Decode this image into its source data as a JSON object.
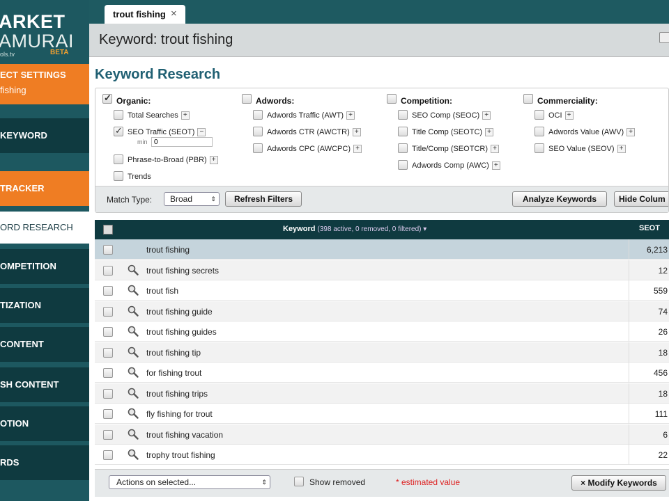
{
  "logo": {
    "line1": "ARKET",
    "line2": "AMURAI",
    "line3": "ols.tv",
    "beta": "BETA"
  },
  "sidebar": {
    "items": [
      {
        "label": "ECT SETTINGS",
        "sub": "fishing"
      },
      {
        "label": "KEYWORD"
      },
      {
        "label": "TRACKER"
      },
      {
        "label": "ORD RESEARCH"
      },
      {
        "label": "OMPETITION"
      },
      {
        "label": "TIZATION"
      },
      {
        "label": "CONTENT"
      },
      {
        "label": "SH CONTENT"
      },
      {
        "label": "OTION"
      },
      {
        "label": "RDS"
      }
    ]
  },
  "tab": {
    "label": "trout fishing",
    "close": "×"
  },
  "header": {
    "title": "Keyword: trout fishing"
  },
  "section_title": "Keyword Research",
  "filters": {
    "organic": {
      "title": "Organic:",
      "items": [
        "Total Searches",
        "SEO Traffic (SEOT)",
        "Phrase-to-Broad (PBR)",
        "Trends"
      ],
      "min_label": "min",
      "min_value": "0"
    },
    "adwords": {
      "title": "Adwords:",
      "items": [
        "Adwords Traffic (AWT)",
        "Adwords CTR (AWCTR)",
        "Adwords CPC (AWCPC)"
      ]
    },
    "competition": {
      "title": "Competition:",
      "items": [
        "SEO Comp (SEOC)",
        "Title Comp (SEOTC)",
        "Title/Comp (SEOTCR)",
        "Adwords Comp (AWC)"
      ]
    },
    "commerciality": {
      "title": "Commerciality:",
      "items": [
        "OCI",
        "Adwords Value (AWV)",
        "SEO Value (SEOV)"
      ]
    },
    "plus": "+",
    "minus": "−"
  },
  "filter_bar": {
    "match_type_label": "Match Type:",
    "match_type_value": "Broad",
    "refresh_label": "Refresh Filters",
    "analyze_label": "Analyze Keywords",
    "hide_label": "Hide Colum"
  },
  "table": {
    "header_keyword": "Keyword",
    "header_sub": "(398 active, 0 removed, 0 filtered) ▾",
    "header_seot": "SEOT",
    "rows": [
      {
        "keyword": "trout fishing",
        "seot": "6,213"
      },
      {
        "keyword": "trout fishing secrets",
        "seot": "12"
      },
      {
        "keyword": "trout fish",
        "seot": "559"
      },
      {
        "keyword": "trout fishing guide",
        "seot": "74"
      },
      {
        "keyword": "trout fishing guides",
        "seot": "26"
      },
      {
        "keyword": "trout fishing tip",
        "seot": "18"
      },
      {
        "keyword": "for fishing trout",
        "seot": "456"
      },
      {
        "keyword": "trout fishing trips",
        "seot": "18"
      },
      {
        "keyword": "fly fishing for trout",
        "seot": "111"
      },
      {
        "keyword": "trout fishing vacation",
        "seot": "6"
      },
      {
        "keyword": "trophy trout fishing",
        "seot": "22"
      }
    ]
  },
  "bottom_bar": {
    "actions_label": "Actions on selected...",
    "show_removed_label": "Show removed",
    "estimated_label": "* estimated value",
    "modify_label": "× Modify Keywords"
  },
  "colors": {
    "sidebar": "#1d5860",
    "accent_orange": "#ef7d23",
    "header_dark": "#0f3a40",
    "title_blue": "#1f5f72"
  }
}
